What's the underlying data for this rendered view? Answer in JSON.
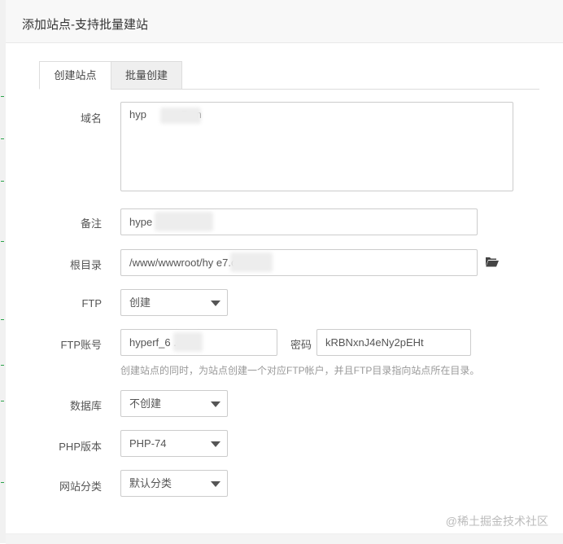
{
  "dialog": {
    "title": "添加站点-支持批量建站"
  },
  "tabs": [
    {
      "label": "创建站点",
      "active": true
    },
    {
      "label": "批量创建",
      "active": false
    }
  ],
  "form": {
    "domain": {
      "label": "域名",
      "value": "hyp          e7.cn"
    },
    "remark": {
      "label": "备注",
      "value": "hype"
    },
    "root": {
      "label": "根目录",
      "value": "/www/wwwroot/hy           e7.cn"
    },
    "ftp": {
      "label": "FTP",
      "selected": "创建"
    },
    "ftp_account": {
      "label": "FTP账号",
      "value": "hyperf_6        .cn"
    },
    "password": {
      "label": "密码",
      "value": "kRBNxnJ4eNy2pEHt"
    },
    "ftp_hint": "创建站点的同时，为站点创建一个对应FTP帐户，并且FTP目录指向站点所在目录。",
    "database": {
      "label": "数据库",
      "selected": "不创建"
    },
    "php": {
      "label": "PHP版本",
      "selected": "PHP-74"
    },
    "category": {
      "label": "网站分类",
      "selected": "默认分类"
    }
  },
  "watermark": "@稀土掘金技术社区",
  "colors": {
    "accent": "#20a53a",
    "border": "#cccccc",
    "hint": "#999999"
  }
}
